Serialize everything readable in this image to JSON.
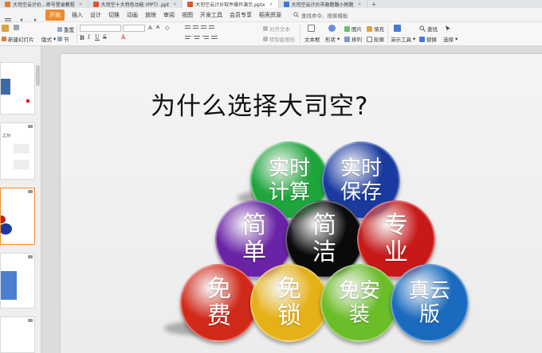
{
  "tabs": [
    {
      "label": "大司空云计价...密号登录教程",
      "color": "#e57b2c",
      "active": false
    },
    {
      "label": "大司空十大特色功能 (PPT) .ppt",
      "color": "#e5532c",
      "active": false
    },
    {
      "label": "大司空云计价软件操作演示.pptx",
      "color": "#e5532c",
      "active": true
    },
    {
      "label": "大司空云计价市政题路小例题",
      "color": "#3b78d6",
      "active": false
    }
  ],
  "menubar": {
    "items": [
      "开始",
      "插入",
      "设计",
      "切换",
      "动画",
      "放映",
      "审阅",
      "视图",
      "开发工具",
      "会员专享",
      "稻壳资源"
    ],
    "active_index": 0,
    "search_text": "查找命令、搜索模板"
  },
  "ribbon": {
    "new_slide": "新建幻灯片",
    "layout": "版式",
    "section": "节",
    "reset": "重置",
    "align_text": "对齐文本",
    "smartart": "转智能图形",
    "textbox": "文本框",
    "shape": "形状",
    "picture": "图片",
    "arrange": "排列",
    "fill": "填充",
    "outline": "轮廓",
    "presentation_tool": "演示工具",
    "find": "查找",
    "replace": "替换",
    "select": "选择",
    "format_labels": [
      "B",
      "I",
      "U",
      "S",
      "A"
    ]
  },
  "slide": {
    "title": "为什么选择大司空?",
    "balls": [
      {
        "label": "实时\n计算",
        "color": "#1ea53c"
      },
      {
        "label": "实时\n保存",
        "color": "#1a3aa0"
      },
      {
        "label": "简\n单",
        "color": "#6a22a6"
      },
      {
        "label": "简\n洁",
        "color": "#0a0a0a"
      },
      {
        "label": "专\n业",
        "color": "#c81818"
      },
      {
        "label": "免\n费",
        "color": "#d12a1a"
      },
      {
        "label": "免\n锁",
        "color": "#e6b116"
      },
      {
        "label": "免安\n装",
        "color": "#6bbd2a"
      },
      {
        "label": "真云\n版",
        "color": "#1a6bc0"
      }
    ]
  },
  "thumbnails": {
    "thumb2_text": "之功"
  }
}
